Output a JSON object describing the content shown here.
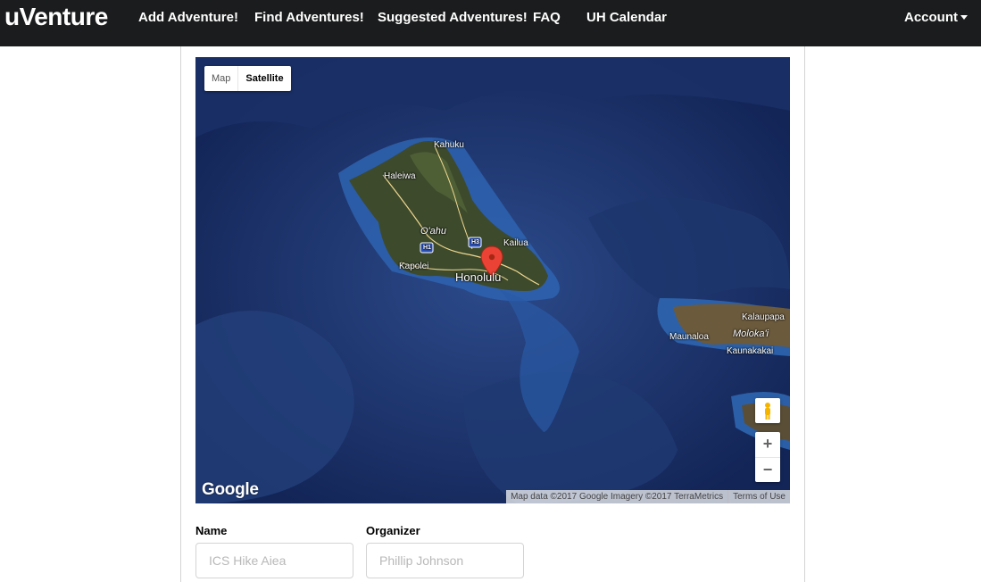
{
  "nav": {
    "brand": "uVenture",
    "items": [
      {
        "label": "Add Adventure!"
      },
      {
        "label": "Find Adventures!"
      },
      {
        "label": "Suggested Adventures!"
      },
      {
        "label": "FAQ"
      },
      {
        "label": "UH Calendar"
      }
    ],
    "account": "Account",
    "account_icon": "caret-down-icon"
  },
  "map": {
    "type_options": [
      "Map",
      "Satellite"
    ],
    "selected_type": "Satellite",
    "places": {
      "kahuku": "Kahuku",
      "haleiwa": "Haleiwa",
      "oahu": "O'ahu",
      "kailua": "Kailua",
      "kapolei": "Kapolei",
      "honolulu": "Honolulu",
      "kalaupapa": "Kalaupapa",
      "molokai": "Moloka'i",
      "maunaloa": "Maunaloa",
      "kaunakakai": "Kaunakakai"
    },
    "highway_shields": [
      "H1",
      "H3"
    ],
    "zoom_in": "+",
    "zoom_out": "−",
    "logo": "Google",
    "attribution": "Map data ©2017 Google Imagery ©2017 TerraMetrics",
    "terms": "Terms of Use",
    "icons": [
      "marker-pin-icon",
      "pegman-icon"
    ]
  },
  "form": {
    "name_label": "Name",
    "name_placeholder": "ICS Hike Aiea",
    "organizer_label": "Organizer",
    "organizer_placeholder": "Phillip Johnson"
  },
  "colors": {
    "navbar": "#1b1c1d",
    "ocean_deep": "#14285a",
    "ocean_shelf": "#2d5fa6",
    "land": "#3d4a2c",
    "marker": "#ea4335"
  }
}
